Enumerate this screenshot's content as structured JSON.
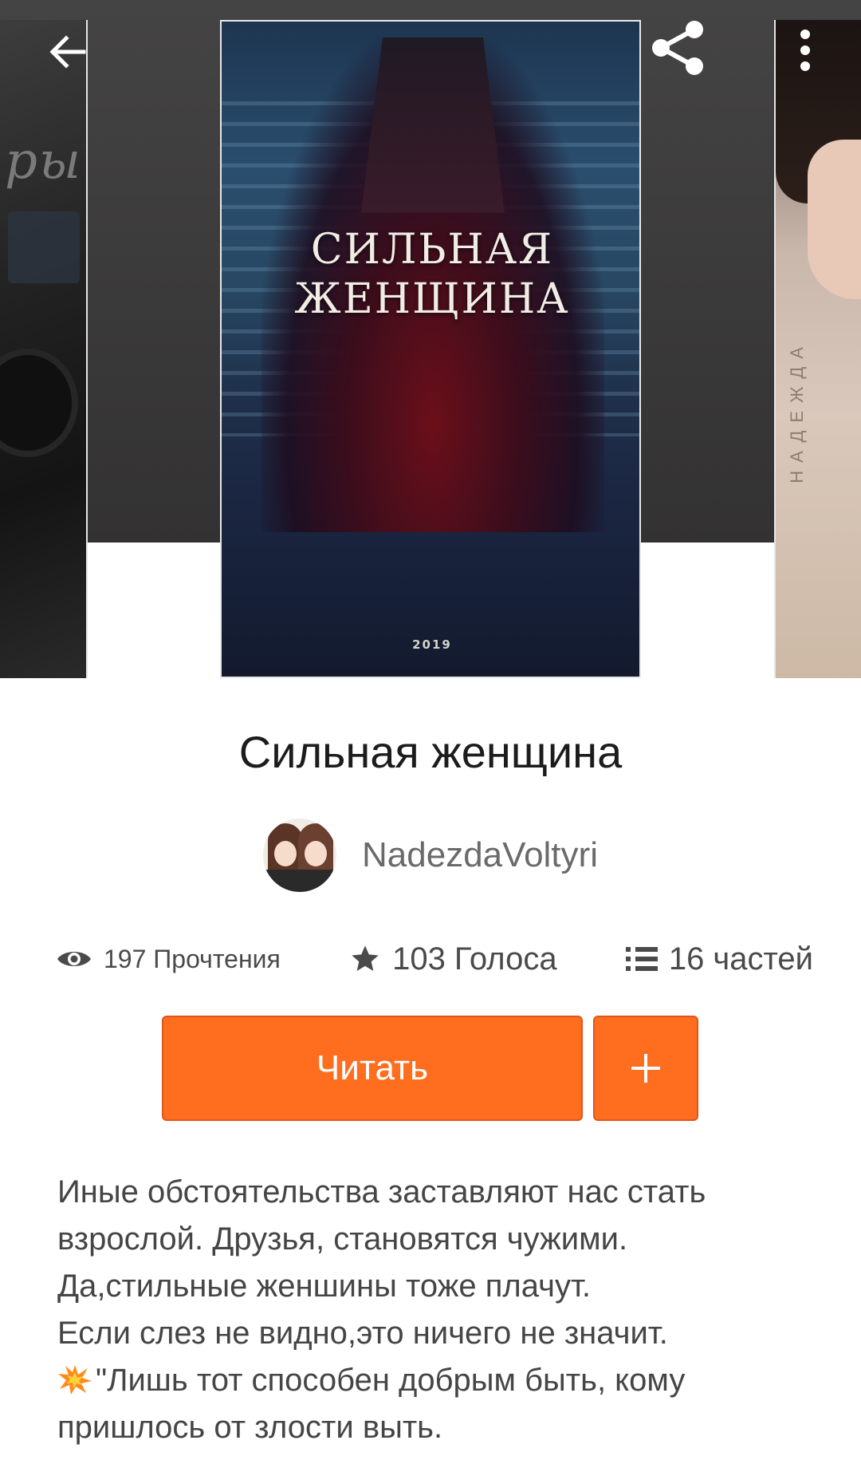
{
  "cover": {
    "title_line1": "СИЛЬНАЯ",
    "title_line2": "ЖЕНЩИНА",
    "year": "2019"
  },
  "side_covers": {
    "left_text": "ры",
    "right_text": "НАДЕЖДА"
  },
  "top_bar": {
    "back_icon": "arrow-left-icon",
    "share_icon": "share-icon",
    "more_icon": "more-vertical-icon"
  },
  "book": {
    "title": "Сильная женщина",
    "author": "NadezdaVoltyri"
  },
  "stats": {
    "reads": "197 Прочтения",
    "votes": "103 Голоса",
    "parts": "16 частей"
  },
  "actions": {
    "read_label": "Читать",
    "add_label": "+"
  },
  "description": {
    "lines": [
      "Иные обстоятельства заставляют нас стать",
      "взрослой. Друзья, становятся чужими.",
      "Да,стильные женшины тоже плачут.",
      "Если слез не видно,это ничего не значит.",
      "\"Лишь тот способен добрым быть, кому",
      "пришлось от злости выть."
    ]
  },
  "colors": {
    "accent": "#ff6d1f",
    "hero_bg": "#3a3939",
    "text_primary": "#1c1c1c",
    "text_secondary": "#4a4a4a"
  }
}
